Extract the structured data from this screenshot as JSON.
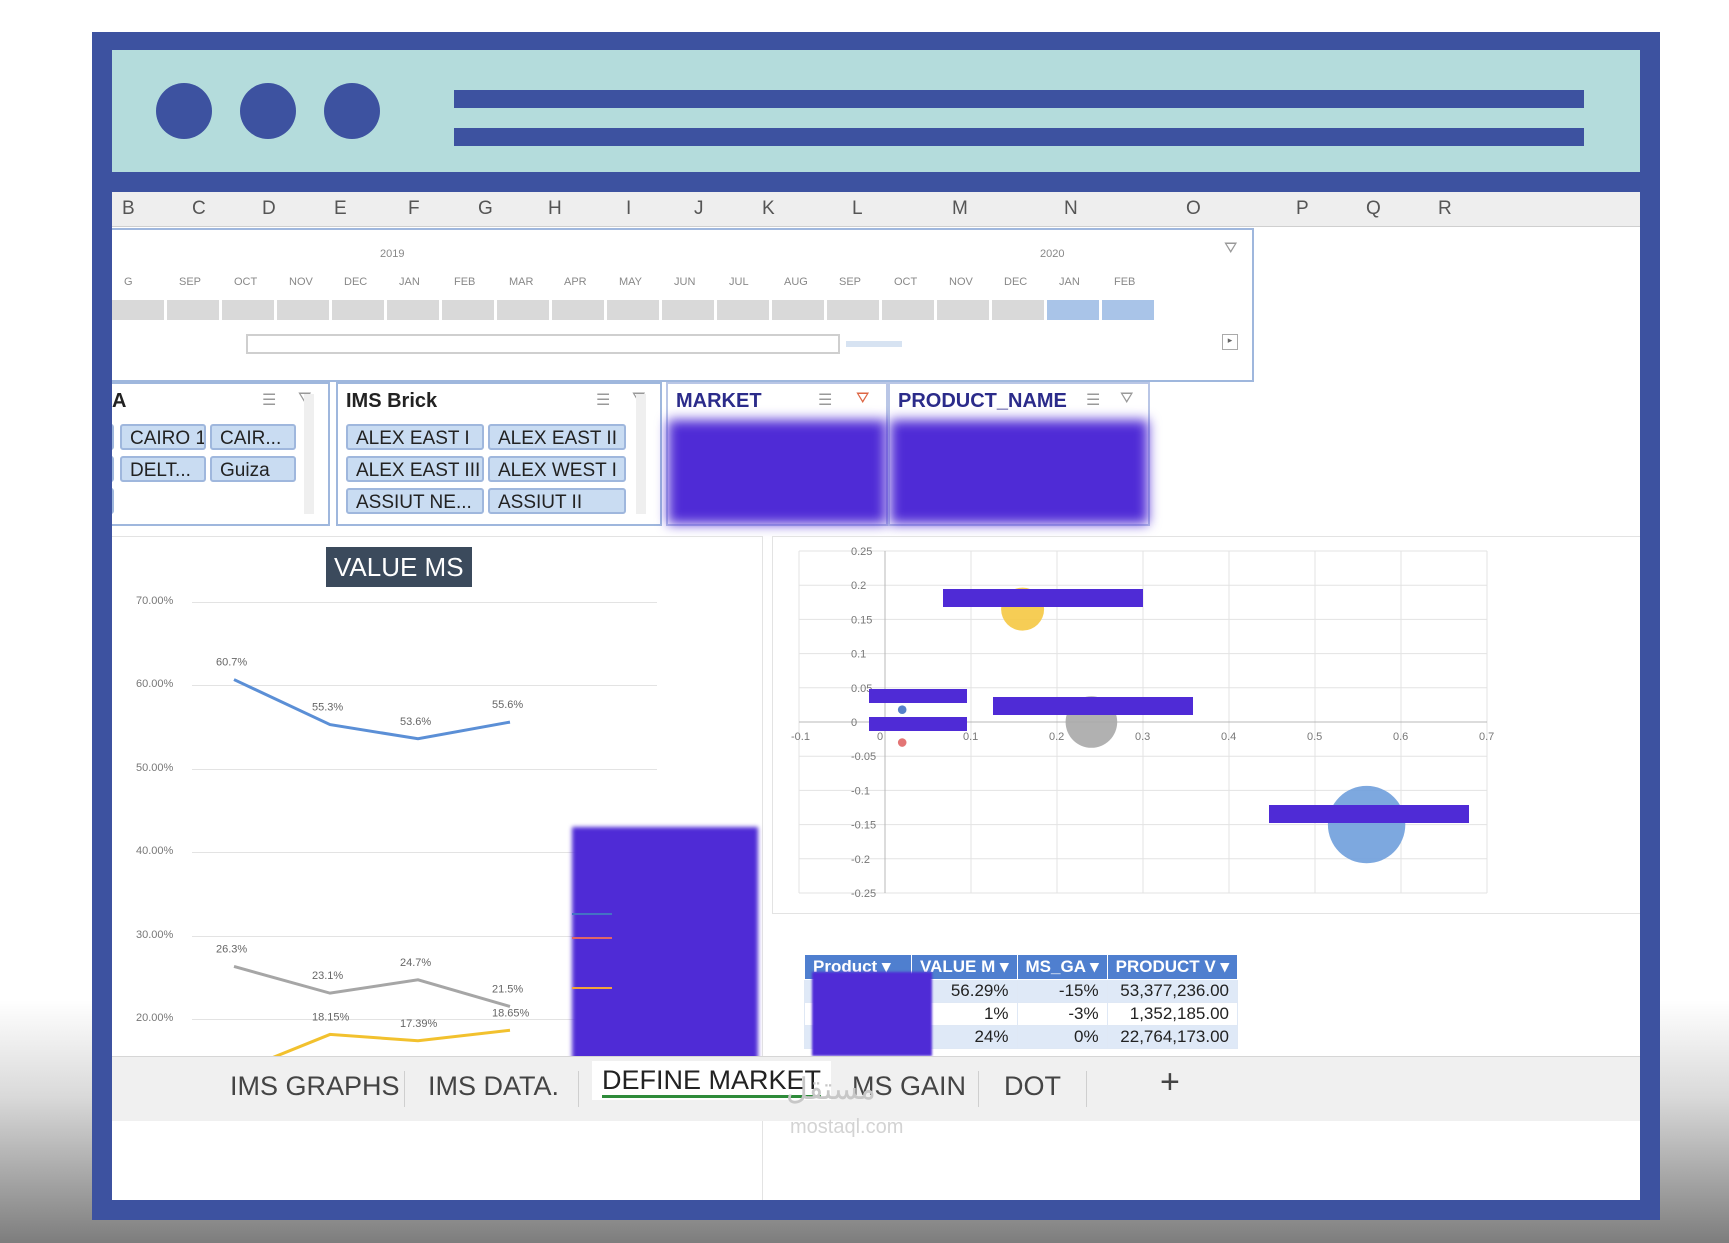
{
  "colors": {
    "frame": "#3d52a0",
    "titlebar": "#b4dcdc",
    "redaction": "#4f2bd6",
    "active_tab_underline": "#2e8b3a"
  },
  "columns": [
    "B",
    "C",
    "D",
    "E",
    "F",
    "G",
    "H",
    "I",
    "J",
    "K",
    "L",
    "M",
    "N",
    "O",
    "P",
    "Q",
    "R"
  ],
  "timeline": {
    "years": [
      "2019",
      "2020"
    ],
    "months": [
      "G",
      "SEP",
      "OCT",
      "NOV",
      "DEC",
      "JAN",
      "FEB",
      "MAR",
      "APR",
      "MAY",
      "JUN",
      "JUL",
      "AUG",
      "SEP",
      "OCT",
      "NOV",
      "DEC",
      "JAN",
      "FEB"
    ],
    "selected_from_index": 17,
    "clear_filter_icon": "clear-filter-icon"
  },
  "slicers": {
    "area": {
      "title": "A",
      "items": [
        "CAIRO 1",
        "CAIR...",
        "DELT...",
        "Guiza"
      ]
    },
    "ims_brick": {
      "title": "IMS Brick",
      "items": [
        "ALEX EAST I",
        "ALEX EAST II",
        "ALEX EAST III",
        "ALEX WEST I",
        "ASSIUT NE...",
        "ASSIUT II"
      ]
    },
    "market": {
      "title": "MARKET"
    },
    "product_name": {
      "title": "PRODUCT_NAME"
    }
  },
  "line_chart": {
    "title": "VALUE MS",
    "y_ticks": [
      "70.00%",
      "60.00%",
      "50.00%",
      "40.00%",
      "30.00%",
      "20.00%"
    ]
  },
  "chart_data": [
    {
      "type": "line",
      "title": "VALUE MS",
      "ylim": [
        0.2,
        0.7
      ],
      "y_ticks": [
        "70.00%",
        "60.00%",
        "50.00%",
        "40.00%",
        "30.00%",
        "20.00%"
      ],
      "series": [
        {
          "color": "#5b8fd6",
          "values": [
            0.607,
            0.553,
            0.536,
            0.556
          ],
          "labels": [
            "60.7%",
            "55.3%",
            "53.6%",
            "55.6%"
          ]
        },
        {
          "color": "#a6a6a6",
          "values": [
            0.263,
            0.231,
            0.247,
            0.215
          ],
          "labels": [
            "26.3%",
            "23.1%",
            "24.7%",
            "21.5%"
          ]
        },
        {
          "color": "#f2c12e",
          "values": [
            0.135,
            0.1815,
            0.1739,
            0.1865
          ],
          "labels": [
            "",
            "18.15%",
            "17.39%",
            "18.65%"
          ]
        }
      ]
    },
    {
      "type": "scatter",
      "xlim": [
        -0.1,
        0.7
      ],
      "ylim": [
        -0.25,
        0.25
      ],
      "x_ticks": [
        "-0.1",
        "0",
        "0.1",
        "0.2",
        "0.3",
        "0.4",
        "0.5",
        "0.6",
        "0.7"
      ],
      "y_ticks": [
        "0.25",
        "0.2",
        "0.15",
        "0.1",
        "0.05",
        "0",
        "-0.05",
        "-0.1",
        "-0.15",
        "-0.2",
        "-0.25"
      ],
      "points": [
        {
          "x": 0.16,
          "y": 0.165,
          "size": 0.05,
          "color": "#f5c842"
        },
        {
          "x": 0.24,
          "y": 0.0,
          "size": 0.06,
          "color": "#a8a8a8"
        },
        {
          "x": 0.56,
          "y": -0.15,
          "size": 0.09,
          "color": "#6f9fdc"
        },
        {
          "x": 0.02,
          "y": 0.018,
          "size": 0.01,
          "color": "#4472c4"
        },
        {
          "x": 0.02,
          "y": -0.03,
          "size": 0.01,
          "color": "#e06666"
        }
      ]
    }
  ],
  "product_table": {
    "headers": [
      "Product",
      "VALUE M",
      "MS_GA",
      "PRODUCT V"
    ],
    "rows": [
      [
        "",
        "56.29%",
        "-15%",
        "53,377,236.00"
      ],
      [
        "",
        "1%",
        "-3%",
        "1,352,185.00"
      ],
      [
        "",
        "24%",
        "0%",
        "22,764,173.00"
      ]
    ]
  },
  "tabs": [
    {
      "label": "IMS GRAPHS",
      "active": false
    },
    {
      "label": "IMS DATA.",
      "active": false
    },
    {
      "label": "DEFINE MARKET",
      "active": true
    },
    {
      "label": "MS GAIN",
      "active": false
    },
    {
      "label": "DOT",
      "active": false
    }
  ],
  "add_tab_label": "+",
  "watermark": {
    "latin": "mostaql.com",
    "arabic": "مستقل"
  }
}
